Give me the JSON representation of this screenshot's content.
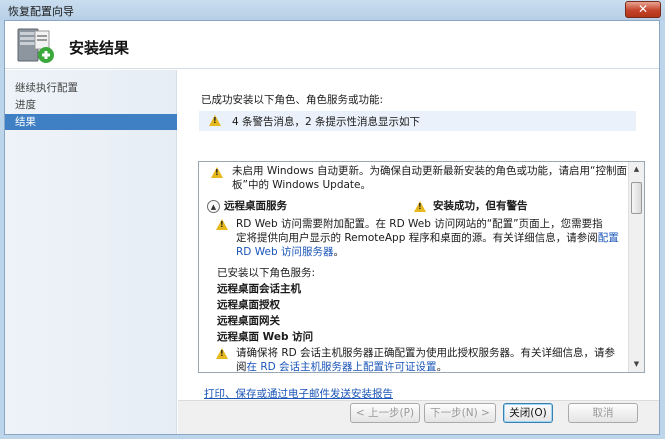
{
  "window": {
    "title": "恢复配置向导",
    "close_label": "✕"
  },
  "header": {
    "title": "安装结果",
    "icon": "server-install-icon"
  },
  "sidebar": {
    "items": [
      {
        "label": "继续执行配置"
      },
      {
        "label": "进度"
      },
      {
        "label": "结果"
      }
    ],
    "active_index": 2
  },
  "main": {
    "intro": "已成功安装以下角色、角色服务或功能:",
    "summary": "4 条警告消息，2 条提示性消息显示如下",
    "details": {
      "update_warning_1": "未启用 Windows 自动更新。为确保自动更新最新安装的角色或功能，请启用“控制面",
      "update_warning_2": "板”中的 Windows Update。",
      "role_title": "远程桌面服务",
      "role_status": "安装成功，但有警告",
      "rdweb_1": "RD Web 访问需要附加配置。在 RD Web 访问网站的“配置”页面上，您需要指",
      "rdweb_2": "定将提供向用户显示的 RemoteApp 程序和桌面的源。有关详细信息，请参阅",
      "rdweb_link_1": "配置",
      "rdweb_link_2": "RD Web 访问服务器",
      "rdweb_end": "。",
      "installed_header": "已安装以下角色服务:",
      "services": [
        "远程桌面会话主机",
        "远程桌面授权",
        "远程桌面网关",
        "远程桌面 Web 访问"
      ],
      "lic_1": "请确保将 RD 会话主机服务器正确配置为使用此授权服务器。有关详细信息，请参",
      "lic_2_pre": "阅",
      "lic_2_link": "在 RD 会话主机服务器上配置许可证设置",
      "lic_2_end": "。"
    },
    "report_link": "打印、保存或通过电子邮件发送安装报告"
  },
  "footer": {
    "prev": "< 上一步(P)",
    "next": "下一步(N) >",
    "close": "关闭(O)",
    "cancel": "取消"
  }
}
